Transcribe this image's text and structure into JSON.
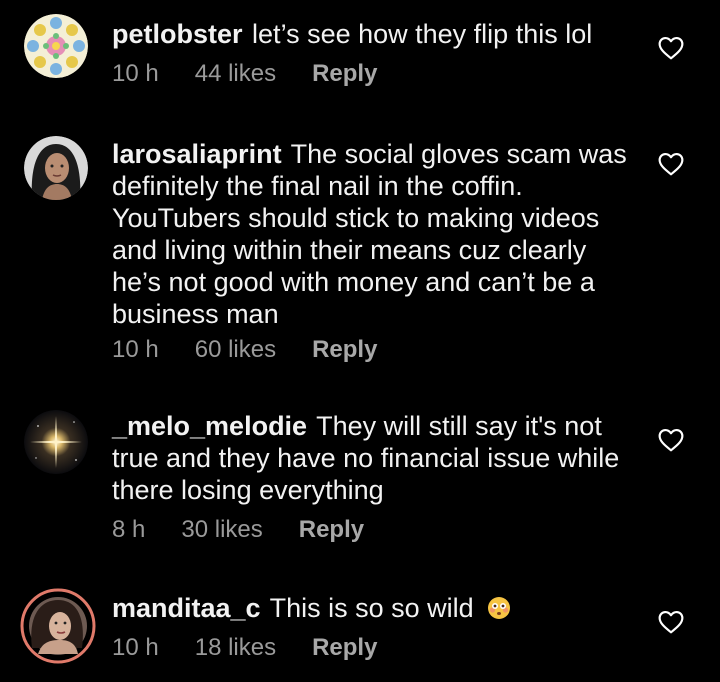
{
  "comments": [
    {
      "username": "petlobster",
      "text": "let’s see how they flip this lol",
      "time": "10 h",
      "likes": "44 likes",
      "reply": "Reply",
      "avatar_icon": "flower-pattern-avatar"
    },
    {
      "username": "larosaliaprint",
      "text": "The social gloves scam was definitely the final nail in the coffin. YouTubers should stick to making videos and living within their means cuz clearly he’s not good with money and can’t be a business man",
      "time": "10 h",
      "likes": "60 likes",
      "reply": "Reply",
      "avatar_icon": "portrait-avatar"
    },
    {
      "username": "_melo_melodie",
      "text": "They will still say it's not true and they have no financial issue while there losing everything",
      "time": "8 h",
      "likes": "30 likes",
      "reply": "Reply",
      "avatar_icon": "star-sparkle-avatar"
    },
    {
      "username": "manditaa_c",
      "text": "This is so so wild",
      "time": "10 h",
      "likes": "18 likes",
      "reply": "Reply",
      "avatar_icon": "story-ring-portrait-avatar",
      "emoji": "flushed-face-emoji"
    }
  ],
  "colors": {
    "background": "#000000",
    "text": "#f2f2f2",
    "meta": "#9a9a9a",
    "story_ring": "#e07a6a"
  }
}
